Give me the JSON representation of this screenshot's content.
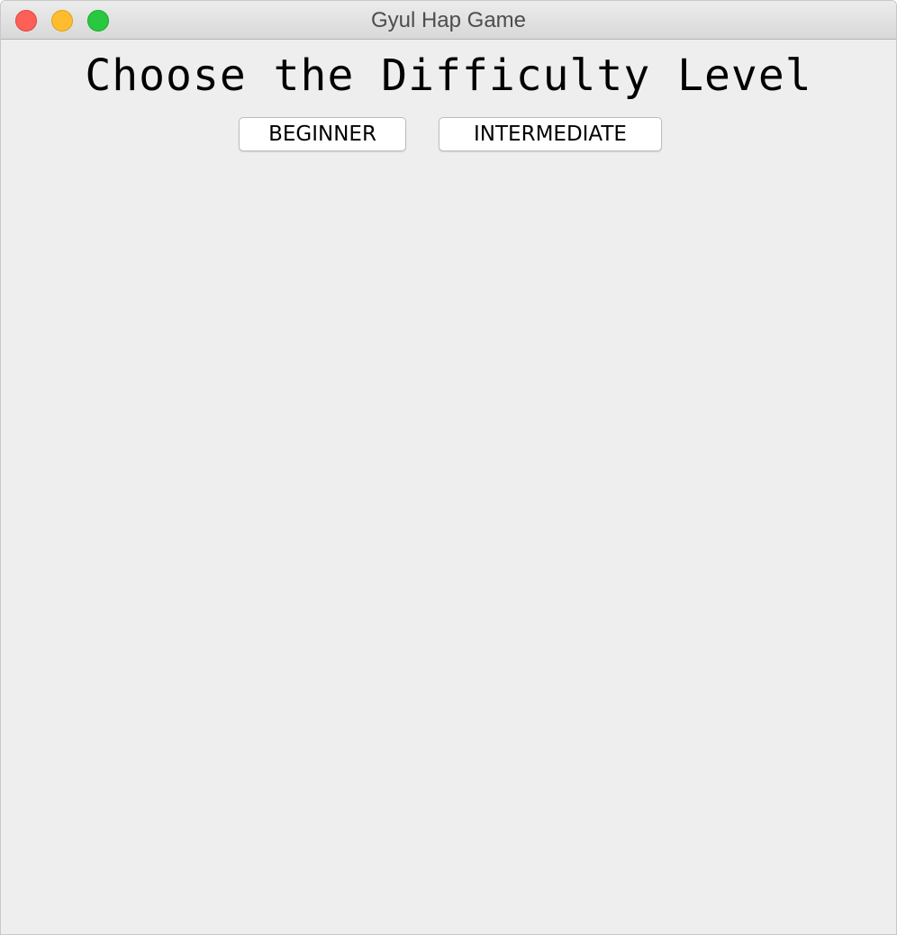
{
  "window": {
    "title": "Gyul Hap Game"
  },
  "main": {
    "heading": "Choose the Difficulty Level",
    "buttons": [
      {
        "label": "BEGINNER"
      },
      {
        "label": "INTERMEDIATE"
      }
    ]
  },
  "colors": {
    "background": "#eeeeee",
    "close": "#fe5f57",
    "minimize": "#febc2e",
    "zoom": "#28c840"
  }
}
